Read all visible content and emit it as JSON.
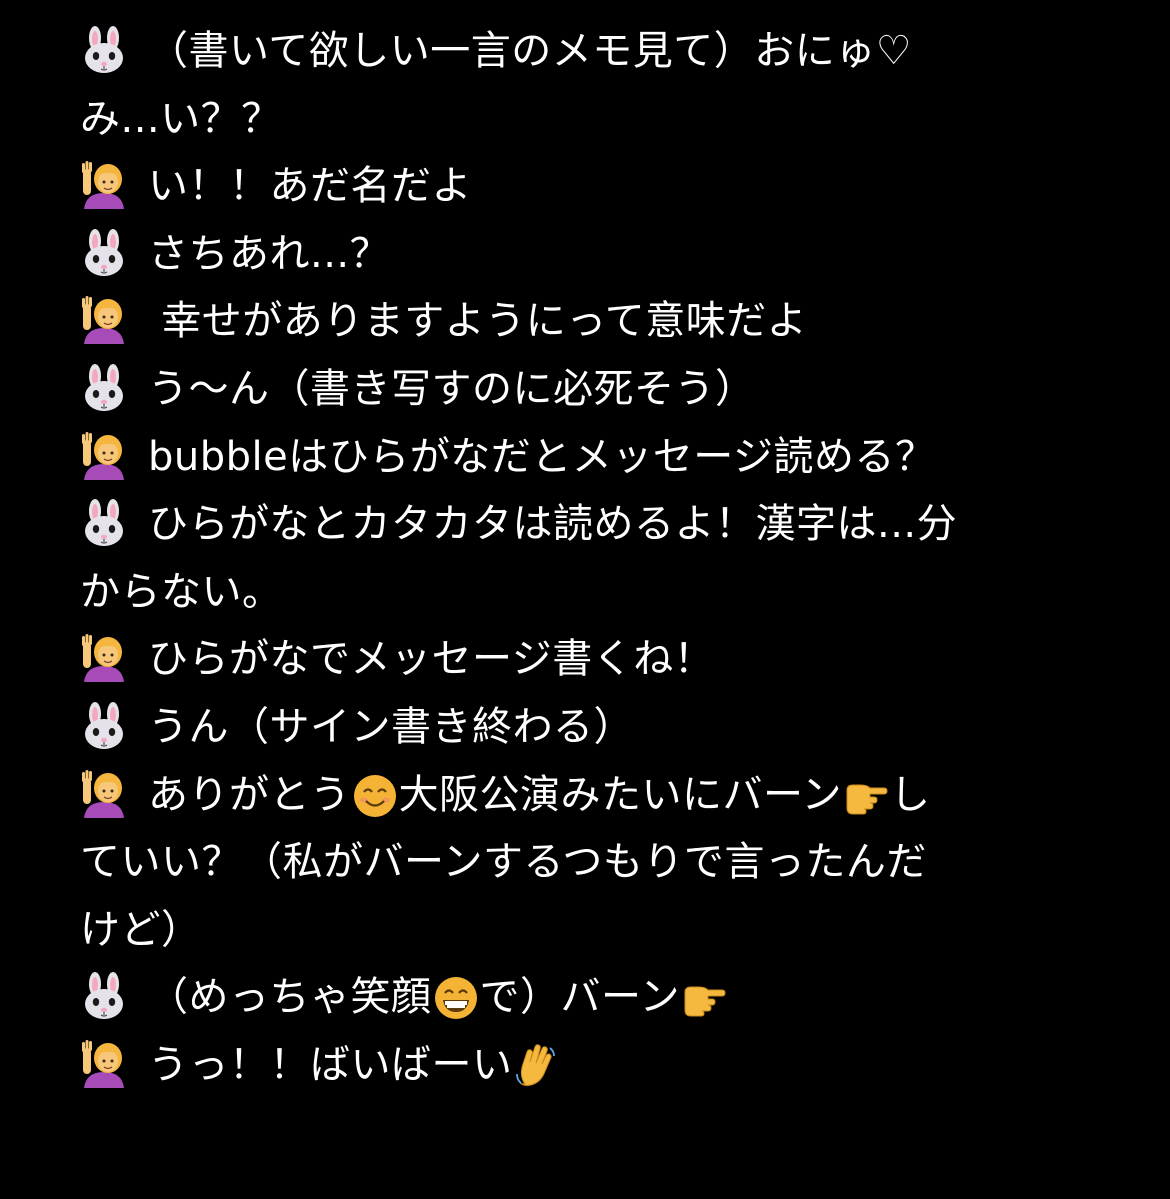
{
  "colors": {
    "background": "#000000",
    "text": "#ffffff",
    "rabbit_fur": "#e6e2ea",
    "rabbit_ear_inner": "#f2a9c0",
    "person_hair": "#f4b63f",
    "person_shirt": "#a64bb7",
    "person_skin": "#f7c77a",
    "smile_face": "#f5b335",
    "pointing_hand": "#f6b93f"
  },
  "lines": [
    {
      "speaker": "rabbit-icon",
      "text": "（書いて欲しい一言のメモ見て）おにゅ♡"
    },
    {
      "speaker": "",
      "text": "み...い？？"
    },
    {
      "speaker": "person-raising-hand-icon",
      "text": "い！！あだ名だよ"
    },
    {
      "speaker": "rabbit-icon",
      "text": "さちあれ...？"
    },
    {
      "speaker": "person-raising-hand-icon",
      "text": " 幸せがありますようにって意味だよ"
    },
    {
      "speaker": "rabbit-icon",
      "text": "う〜ん（書き写すのに必死そう）"
    },
    {
      "speaker": "person-raising-hand-icon",
      "text": "bubbleはひらがなだとメッセージ読める？"
    },
    {
      "speaker": "rabbit-icon",
      "text": "ひらがなとカタカタは読めるよ！漢字は...分"
    },
    {
      "speaker": "",
      "text": "からない。"
    },
    {
      "speaker": "person-raising-hand-icon",
      "text": "ひらがなでメッセージ書くね！"
    },
    {
      "speaker": "rabbit-icon",
      "text": "うん（サイン書き終わる）"
    },
    {
      "speaker": "person-raising-hand-icon",
      "segments": [
        "ありがとう",
        "smiling-face-icon",
        "大阪公演みたいにバーン",
        "pointing-right-icon",
        "し"
      ]
    },
    {
      "speaker": "",
      "text": "ていい？（私がバーンするつもりで言ったんだ"
    },
    {
      "speaker": "",
      "text": "けど）"
    },
    {
      "speaker": "rabbit-icon",
      "segments": [
        "（めっちゃ笑顔",
        "grinning-face-icon",
        "で）バーン",
        "pointing-right-icon"
      ]
    },
    {
      "speaker": "person-raising-hand-icon",
      "segments": [
        "うっ！！ばいばーい",
        "waving-hand-icon"
      ]
    }
  ]
}
